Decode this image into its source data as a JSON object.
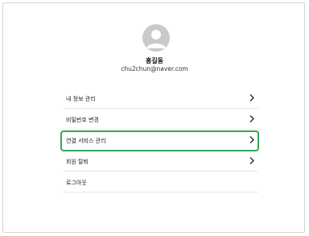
{
  "profile": {
    "avatar_icon": "user-avatar-icon",
    "name": "홍길동",
    "email": "chu2chun@naver.com"
  },
  "menu": {
    "items": [
      {
        "label": "내 정보 관리",
        "icon": "chevron-right-icon",
        "has_chevron": true
      },
      {
        "label": "비밀번호 변경",
        "icon": "chevron-right-icon",
        "has_chevron": true
      },
      {
        "label": "연결 서비스 관리",
        "icon": "chevron-right-icon",
        "has_chevron": true,
        "highlighted": true
      },
      {
        "label": "회원 탈퇴",
        "icon": "chevron-right-icon",
        "has_chevron": true
      },
      {
        "label": "로그아웃",
        "has_chevron": false
      }
    ]
  },
  "colors": {
    "highlight_border": "#34a853",
    "avatar_bg": "#c9c9c9",
    "divider": "#e6e6e6"
  }
}
